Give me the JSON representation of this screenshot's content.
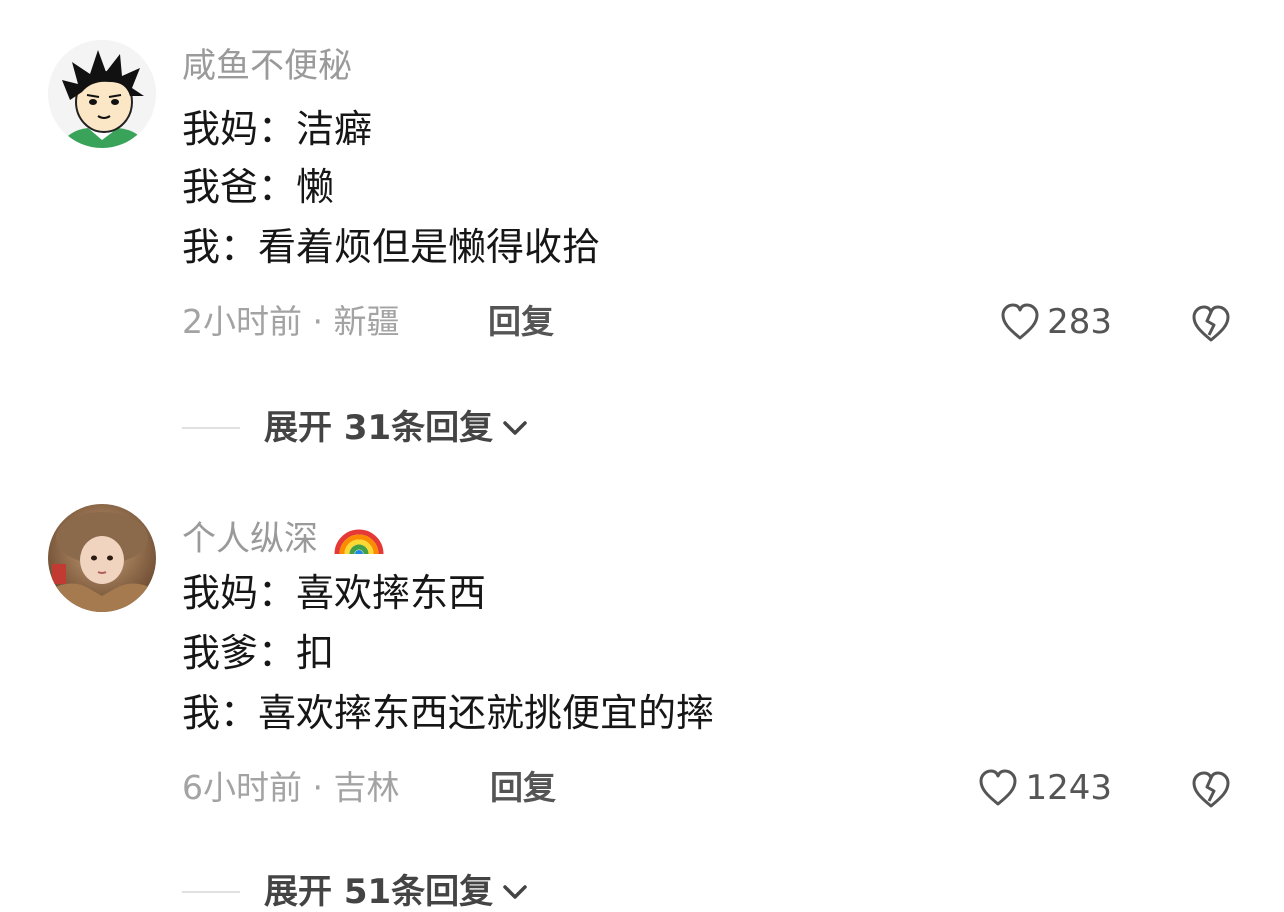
{
  "comments": [
    {
      "username": "咸鱼不便秘",
      "lines": [
        "我妈：洁癖",
        "我爸：懒",
        "我：看着烦但是懒得收拾"
      ],
      "meta": "2小时前 · 新疆",
      "reply_label": "回复",
      "like_count": "283",
      "expand_label": "展开 31条回复",
      "avatar_icon": "cartoon-boy-avatar"
    },
    {
      "username": "个人纵深",
      "username_emoji": "rainbow-icon",
      "lines": [
        "我妈：喜欢摔东西",
        "我爹：扣",
        "我：喜欢摔东西还就挑便宜的摔"
      ],
      "meta": "6小时前 · 吉林",
      "reply_label": "回复",
      "like_count": "1243",
      "expand_label": "展开 51条回复",
      "avatar_icon": "photo-girl-avatar"
    }
  ],
  "icons": {
    "like": "heart-outline-icon",
    "dislike": "broken-heart-icon",
    "expand": "chevron-down-icon"
  }
}
